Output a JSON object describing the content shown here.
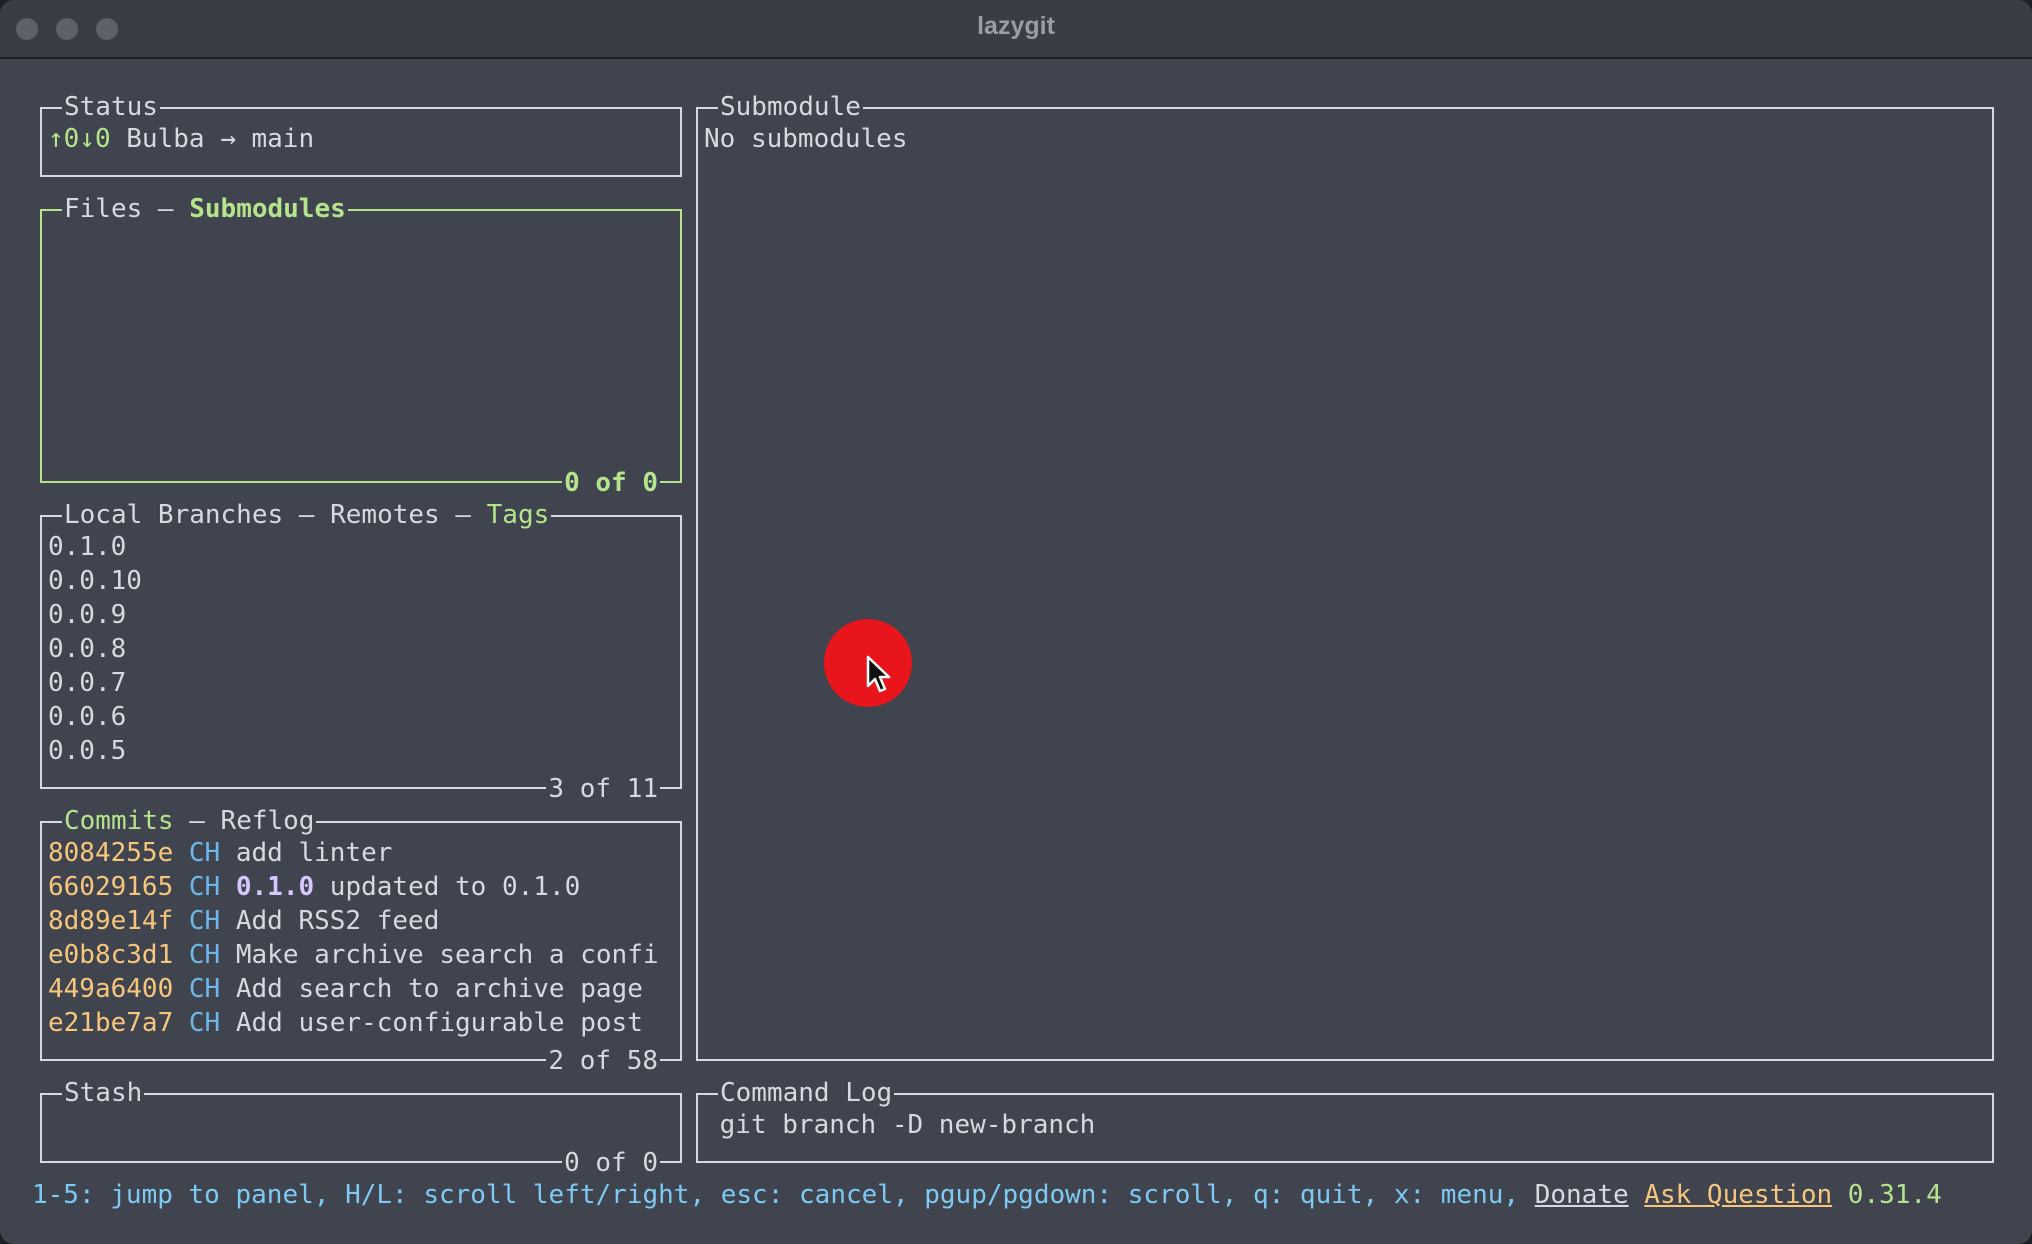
{
  "window": {
    "title": "lazygit"
  },
  "status": {
    "title": "Status",
    "arrows": "↑0↓0",
    "repo_line": " Bulba → main"
  },
  "files": {
    "title_prefix": "Files – ",
    "title_active": "Submodules",
    "footer": "0 of 0"
  },
  "branches": {
    "title_prefix": "Local Branches – Remotes – ",
    "title_active": "Tags",
    "items": [
      "0.1.0",
      "0.0.10",
      "0.0.9",
      "0.0.8",
      "0.0.7",
      "0.0.6",
      "0.0.5"
    ],
    "footer": "3 of 11"
  },
  "commits": {
    "title_active": "Commits",
    "title_suffix": " – Reflog",
    "footer": "2 of 58",
    "rows": [
      {
        "hash": "8084255e",
        "author": "CH",
        "message": "add linter"
      },
      {
        "hash": "66029165",
        "author": "CH",
        "tag": "0.1.0",
        "message": "updated to 0.1.0"
      },
      {
        "hash": "8d89e14f",
        "author": "CH",
        "message": "Add RSS2 feed"
      },
      {
        "hash": "e0b8c3d1",
        "author": "CH",
        "message": "Make archive search a confi"
      },
      {
        "hash": "449a6400",
        "author": "CH",
        "message": "Add search to archive page"
      },
      {
        "hash": "e21be7a7",
        "author": "CH",
        "message": "Add user-configurable post"
      }
    ]
  },
  "stash": {
    "title": "Stash",
    "footer": "0 of 0"
  },
  "submodule": {
    "title": "Submodule",
    "message": "No submodules"
  },
  "command_log": {
    "title": "Command Log",
    "command": " git branch -D new-branch"
  },
  "bottom_bar": {
    "keybindings": "1-5: jump to panel, H/L: scroll left/right, esc: cancel, pgup/pgdown: scroll, q: quit, x: menu, ",
    "donate": "Donate",
    "ask_question": "Ask Question",
    "version": "0.31.4"
  },
  "colors": {
    "background": "#40444f",
    "active_border": "#b5e48c",
    "commit_hash": "#f5c67c",
    "author": "#6cb7e8",
    "keybindings": "#7ec9f2",
    "click_indicator": "#e8151d"
  }
}
